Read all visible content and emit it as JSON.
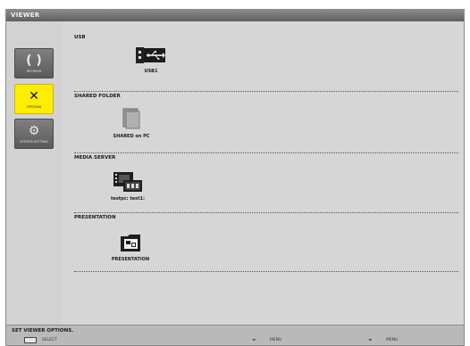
{
  "window": {
    "title": "VIEWER"
  },
  "sidebar": {
    "items": [
      {
        "label": "REFRESH",
        "icon": "refresh-icon",
        "selected": false
      },
      {
        "label": "OPTIONS",
        "icon": "tools-icon",
        "selected": true
      },
      {
        "label": "SYSTEM SETTING",
        "icon": "system-setting-icon",
        "selected": false
      }
    ]
  },
  "sections": [
    {
      "label": "USB",
      "items": [
        {
          "caption": "USB1",
          "icon": "usb-drive-icon"
        }
      ]
    },
    {
      "label": "SHARED FOLDER",
      "items": [
        {
          "caption": "SHARED on PC",
          "icon": "shared-folder-icon"
        }
      ]
    },
    {
      "label": "MEDIA SERVER",
      "items": [
        {
          "caption": "testpc: test1:",
          "icon": "media-server-icon"
        }
      ]
    },
    {
      "label": "PRESENTATION",
      "items": [
        {
          "caption": "PRESENTATION",
          "icon": "presentation-icon"
        }
      ]
    }
  ],
  "footer": {
    "label": "SET VIEWER OPTIONS.",
    "hints": [
      "SELECT",
      "MENU",
      "MENU"
    ]
  },
  "colors": {
    "selected": "#ffee00",
    "titlebar": "#6e6e6e",
    "panel": "#d6d6d6"
  }
}
